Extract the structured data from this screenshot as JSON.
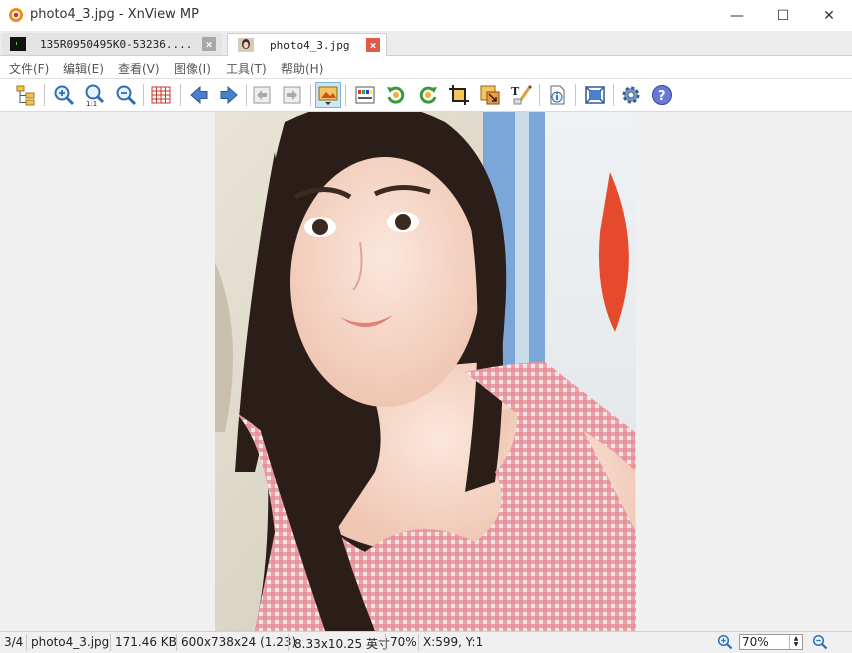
{
  "window": {
    "title": "photo4_3.jpg - XnView MP",
    "minimize_glyph": "—",
    "maximize_glyph": "☐",
    "close_glyph": "✕"
  },
  "tabs": [
    {
      "label": "135R0950495K0-53236....",
      "active": false,
      "icon": "thumbnail-icon"
    },
    {
      "label": "photo4_3.jpg",
      "active": true,
      "icon": "thumbnail-icon"
    }
  ],
  "menu": [
    "文件(F)",
    "编辑(E)",
    "查看(V)",
    "图像(I)",
    "工具(T)",
    "帮助(H)"
  ],
  "toolbar": {
    "icons": [
      "browser-icon",
      "zoom-in-icon",
      "zoom-actual-icon",
      "zoom-out-icon",
      "grid-icon",
      "previous-icon",
      "next-icon",
      "first-page-icon",
      "last-page-icon",
      "fullscreen-filmstrip-icon",
      "adjust-icon",
      "rotate-left-icon",
      "rotate-right-icon",
      "crop-icon",
      "resize-icon",
      "text-annotate-icon",
      "info-icon",
      "fit-window-icon",
      "settings-icon",
      "help-icon"
    ]
  },
  "colors": {
    "accent": "#3b8fd6",
    "tab_close_active": "#e05a4a",
    "tab_close_inactive": "#a8a8a8"
  },
  "status": {
    "index": "3/4",
    "filename": "photo4_3.jpg",
    "filesize": "171.46 KB",
    "dimensions": "600x738x24 (1.23)",
    "print_size": "8.33x10.25 英寸",
    "zoom_percent": "70%",
    "cursor": "X:599, Y:1",
    "zoom_value": "70%"
  }
}
